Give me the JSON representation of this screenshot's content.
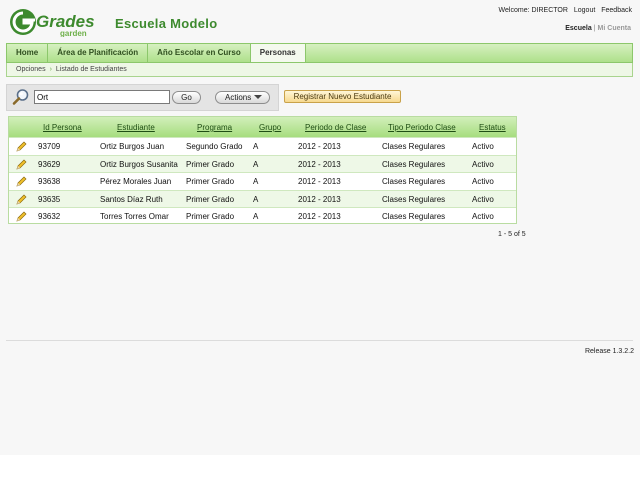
{
  "header": {
    "logo_word": "Grades",
    "logo_sub": "garden",
    "school_name": "Escuela Modelo",
    "welcome": "Welcome: DIRECTOR",
    "logout": "Logout",
    "feedback": "Feedback",
    "account_current": "Escuela",
    "account_other": "Mi Cuenta",
    "brand_color": "#3d8a2e"
  },
  "tabs": [
    {
      "label": "Home",
      "active": false
    },
    {
      "label": "Área de Planificación",
      "active": false
    },
    {
      "label": "Año Escolar en Curso",
      "active": false
    },
    {
      "label": "Personas",
      "active": true
    }
  ],
  "breadcrumb": {
    "parent": "Opciones",
    "current": "Listado de Estudiantes"
  },
  "search": {
    "value": "Ort",
    "go_label": "Go",
    "actions_label": "Actions"
  },
  "register_button": "Registrar Nuevo Estudiante",
  "table": {
    "columns": [
      "Id Persona",
      "Estudiante",
      "Programa",
      "Grupo",
      "Periodo de Clase",
      "Tipo Periodo Clase",
      "Estatus"
    ],
    "rows": [
      [
        "93709",
        "Ortiz Burgos Juan",
        "Segundo Grado",
        "A",
        "2012 - 2013",
        "Clases Regulares",
        "Activo"
      ],
      [
        "93629",
        "Ortiz Burgos Susanita",
        "Primer Grado",
        "A",
        "2012 - 2013",
        "Clases Regulares",
        "Activo"
      ],
      [
        "93638",
        "Pérez Morales Juan",
        "Primer Grado",
        "A",
        "2012 - 2013",
        "Clases Regulares",
        "Activo"
      ],
      [
        "93635",
        "Santos Díaz Ruth",
        "Primer Grado",
        "A",
        "2012 - 2013",
        "Clases Regulares",
        "Activo"
      ],
      [
        "93632",
        "Torres Torres Omar",
        "Primer Grado",
        "A",
        "2012 - 2013",
        "Clases Regulares",
        "Activo"
      ]
    ],
    "pagination": "1 - 5 of 5"
  },
  "footer": {
    "release": "Release 1.3.2.2"
  }
}
